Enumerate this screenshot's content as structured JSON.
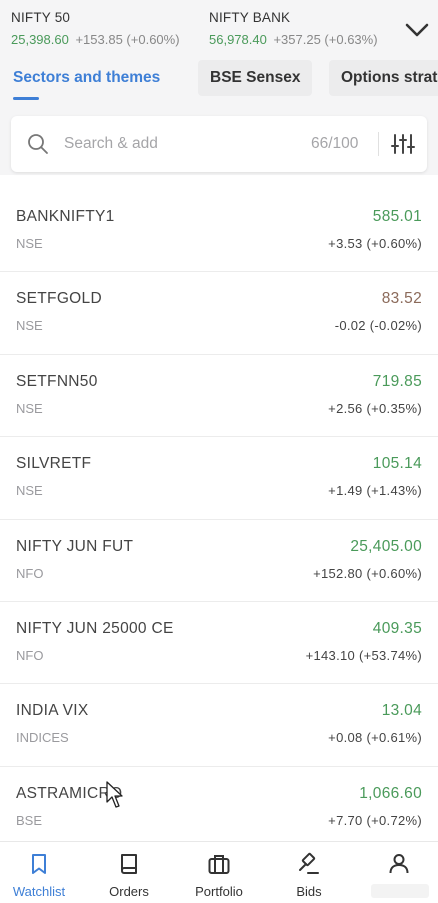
{
  "indices": [
    {
      "name": "NIFTY 50",
      "price": "25,398.60",
      "change": "+153.85 (+0.60%)"
    },
    {
      "name": "NIFTY BANK",
      "price": "56,978.40",
      "change": "+357.25 (+0.63%)"
    }
  ],
  "tabs": [
    {
      "label": "Sectors and themes",
      "active": true
    },
    {
      "label": "BSE Sensex",
      "active": false
    },
    {
      "label": "Options strategies",
      "active": false
    }
  ],
  "search": {
    "placeholder": "Search & add",
    "count": "66/100"
  },
  "colors": {
    "up": "#4a9a5a",
    "down": "#8b6a5a",
    "accent": "#3e7fd6"
  },
  "watchlist": [
    {
      "symbol": "BANKNIFTY1",
      "exchange": "NSE",
      "ltp": "585.01",
      "change": "+3.53 (+0.60%)",
      "direction": "up"
    },
    {
      "symbol": "SETFGOLD",
      "exchange": "NSE",
      "ltp": "83.52",
      "change": "-0.02 (-0.02%)",
      "direction": "down"
    },
    {
      "symbol": "SETFNN50",
      "exchange": "NSE",
      "ltp": "719.85",
      "change": "+2.56 (+0.35%)",
      "direction": "up"
    },
    {
      "symbol": "SILVRETF",
      "exchange": "NSE",
      "ltp": "105.14",
      "change": "+1.49 (+1.43%)",
      "direction": "up"
    },
    {
      "symbol": "NIFTY JUN FUT",
      "exchange": "NFO",
      "ltp": "25,405.00",
      "change": "+152.80 (+0.60%)",
      "direction": "up"
    },
    {
      "symbol": "NIFTY JUN 25000 CE",
      "exchange": "NFO",
      "ltp": "409.35",
      "change": "+143.10 (+53.74%)",
      "direction": "up"
    },
    {
      "symbol": "INDIA VIX",
      "exchange": "INDICES",
      "ltp": "13.04",
      "change": "+0.08 (+0.61%)",
      "direction": "up"
    },
    {
      "symbol": "ASTRAMICRO",
      "exchange": "BSE",
      "ltp": "1,066.60",
      "change": "+7.70 (+0.72%)",
      "direction": "up"
    }
  ],
  "nav": [
    {
      "label": "Watchlist",
      "icon": "bookmark-icon",
      "active": true
    },
    {
      "label": "Orders",
      "icon": "book-icon",
      "active": false
    },
    {
      "label": "Portfolio",
      "icon": "briefcase-icon",
      "active": false
    },
    {
      "label": "Bids",
      "icon": "gavel-icon",
      "active": false
    },
    {
      "label": "",
      "icon": "user-icon",
      "active": false
    }
  ]
}
